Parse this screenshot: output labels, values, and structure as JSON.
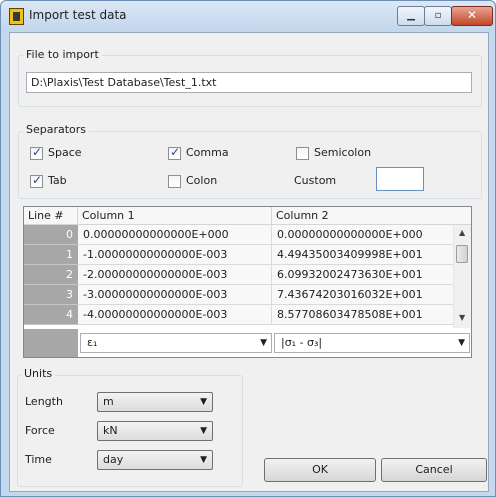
{
  "window": {
    "title": "Import test data",
    "min_glyph": "▁",
    "max_glyph": "▫",
    "close_glyph": "✕"
  },
  "file": {
    "group_label": "File to import",
    "path": "D:\\Plaxis\\Test Database\\Test_1.txt"
  },
  "separators": {
    "group_label": "Separators",
    "space": {
      "label": "Space",
      "checked": true
    },
    "comma": {
      "label": "Comma",
      "checked": true
    },
    "semicolon": {
      "label": "Semicolon",
      "checked": false
    },
    "tab": {
      "label": "Tab",
      "checked": true
    },
    "colon": {
      "label": "Colon",
      "checked": false
    },
    "custom": {
      "label": "Custom",
      "value": ""
    }
  },
  "table": {
    "headers": [
      "Line #",
      "Column 1",
      "Column 2"
    ],
    "rows": [
      {
        "line": "0",
        "c1": "0.00000000000000E+000",
        "c2": "0.00000000000000E+000"
      },
      {
        "line": "1",
        "c1": "-1.00000000000000E-003",
        "c2": "4.49435003409998E+001"
      },
      {
        "line": "2",
        "c1": "-2.00000000000000E-003",
        "c2": "6.09932002473630E+001"
      },
      {
        "line": "3",
        "c1": "-3.00000000000000E-003",
        "c2": "7.43674203016032E+001"
      },
      {
        "line": "4",
        "c1": "-4.00000000000000E-003",
        "c2": "8.57708603478508E+001"
      }
    ],
    "col1_select": "ε₁",
    "col2_select": "|σ₁ - σ₃|"
  },
  "units": {
    "group_label": "Units",
    "length": {
      "label": "Length",
      "value": "m"
    },
    "force": {
      "label": "Force",
      "value": "kN"
    },
    "time": {
      "label": "Time",
      "value": "day"
    }
  },
  "buttons": {
    "ok": "OK",
    "cancel": "Cancel"
  }
}
